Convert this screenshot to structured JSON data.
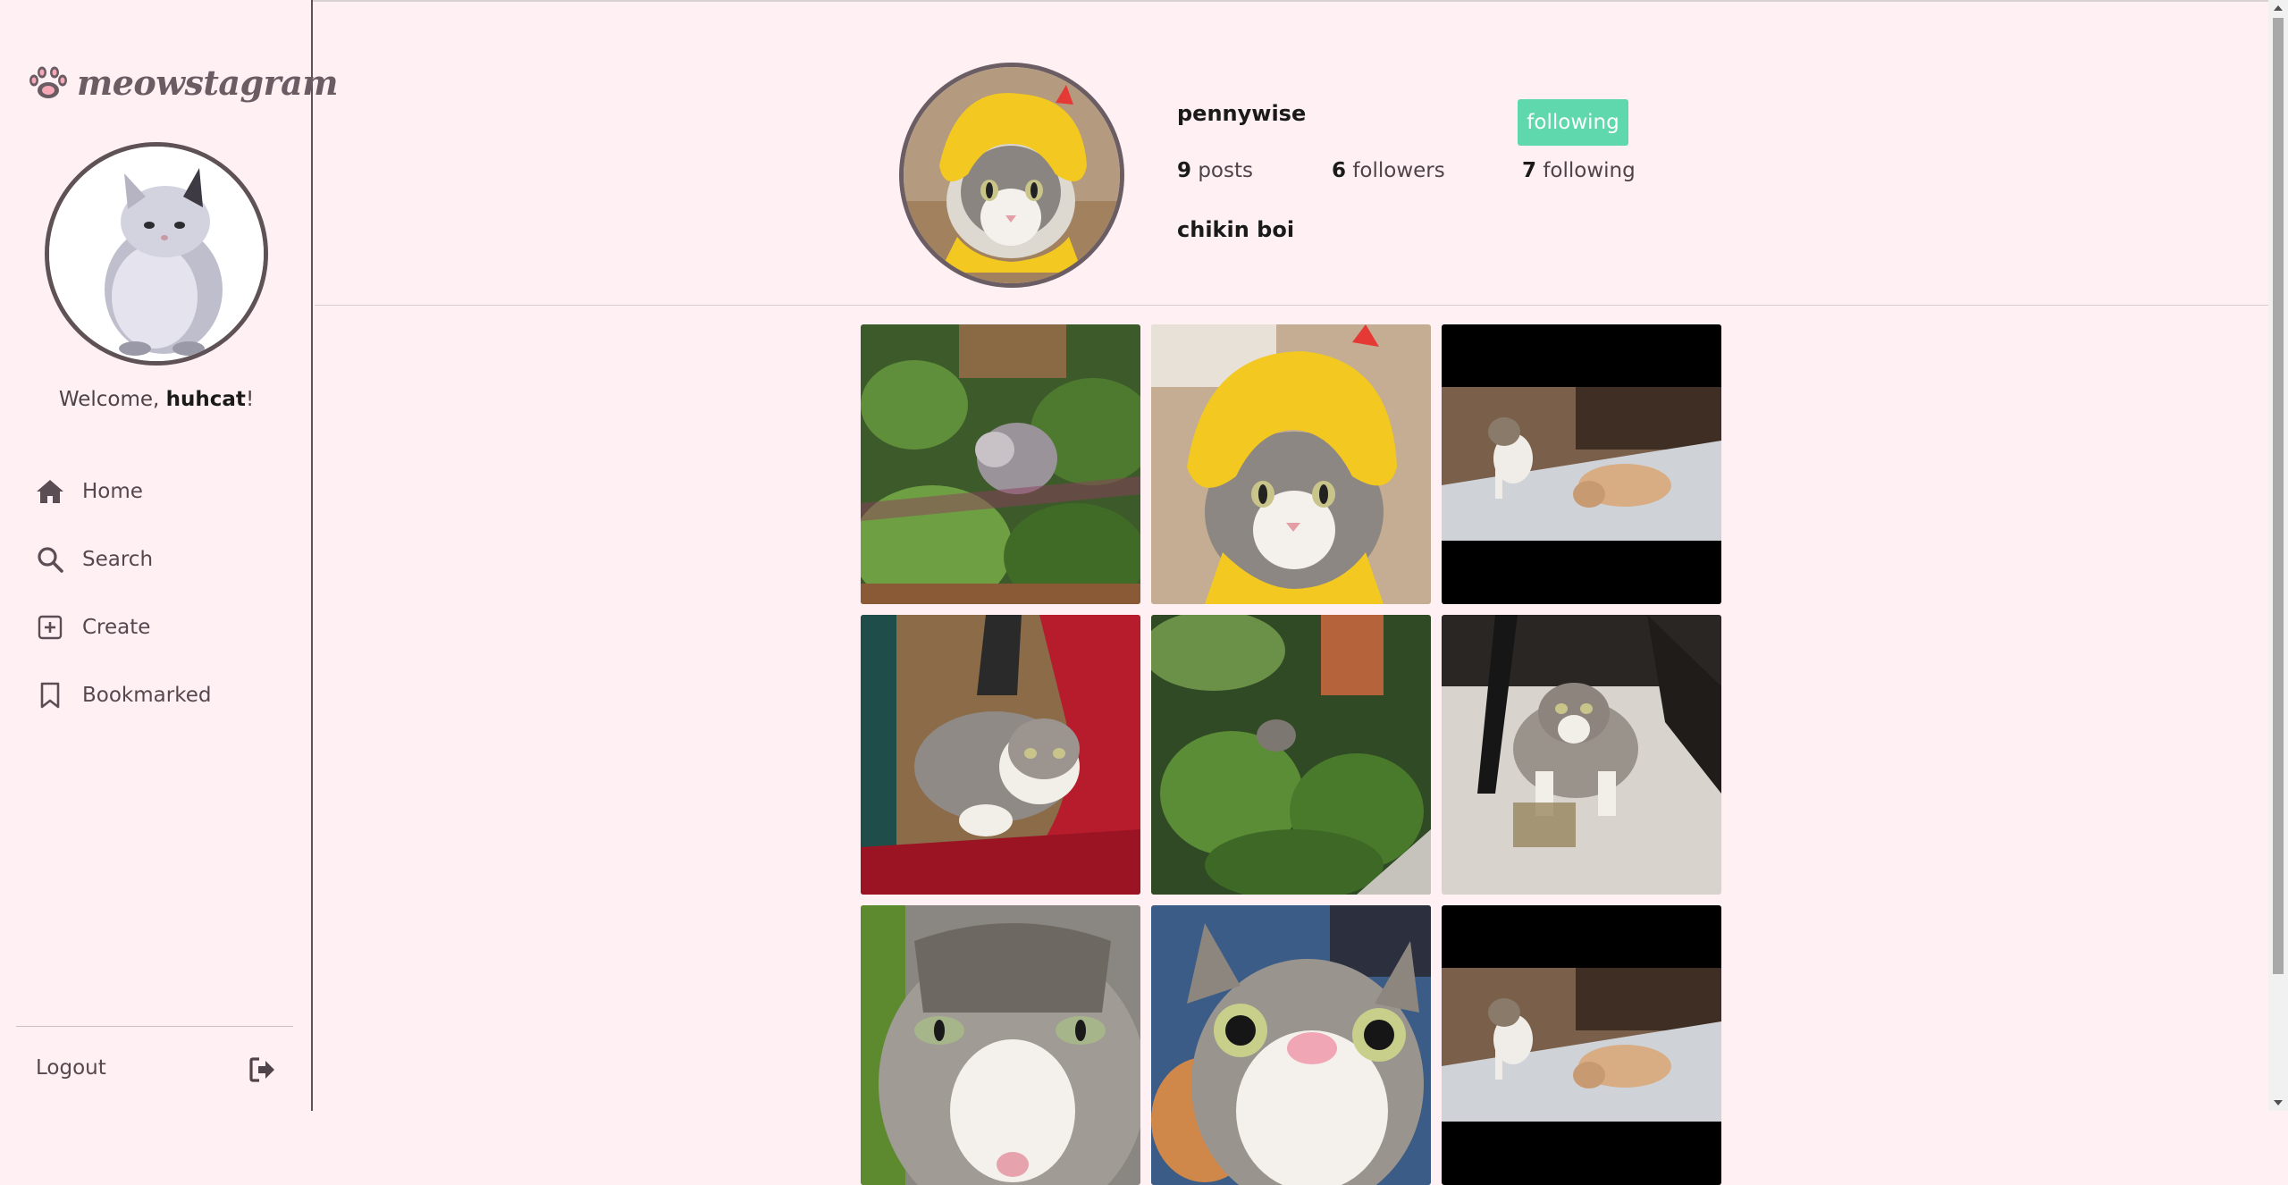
{
  "app": {
    "brand": "meowstagram",
    "brand_color": "#6a5c63",
    "background": "#fff0f4",
    "accent": "#5fd8ad"
  },
  "sidebar": {
    "welcome_prefix": "Welcome, ",
    "current_user": "huhcat",
    "welcome_suffix": "!",
    "nav": [
      {
        "label": "Home",
        "icon": "home-icon"
      },
      {
        "label": "Search",
        "icon": "search-icon"
      },
      {
        "label": "Create",
        "icon": "plus-square-icon"
      },
      {
        "label": "Bookmarked",
        "icon": "bookmark-icon"
      }
    ],
    "logout_label": "Logout"
  },
  "profile": {
    "username": "pennywise",
    "follow_button": "following",
    "posts_count": "9",
    "posts_label": "posts",
    "followers_count": "6",
    "followers_label": "followers",
    "following_count": "7",
    "following_label": "following",
    "bio": "chikin boi"
  },
  "posts": [
    {
      "scene": "cat-in-plants"
    },
    {
      "scene": "cat-yellow-hat"
    },
    {
      "scene": "two-cats-on-bed"
    },
    {
      "scene": "cat-in-bag"
    },
    {
      "scene": "cat-in-garden"
    },
    {
      "scene": "cat-under-chair"
    },
    {
      "scene": "cat-closeup-face"
    },
    {
      "scene": "cat-selfie"
    },
    {
      "scene": "two-cats-on-bed"
    }
  ]
}
